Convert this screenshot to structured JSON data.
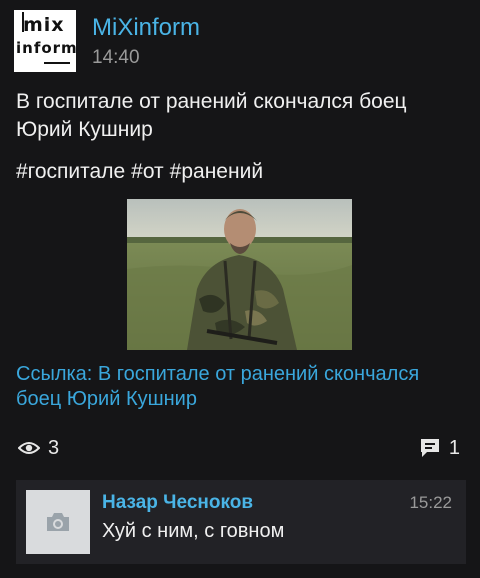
{
  "post": {
    "channel_name": "MiXinform",
    "time": "14:40",
    "logo": {
      "line1": "mix",
      "line2": "inform"
    },
    "text_line1": "В госпитале от ранений скончался боец",
    "text_line2": "Юрий Кушнир",
    "hashtags": [
      "#госпитале",
      "#от",
      "#ранений"
    ],
    "link_text": "Ссылка: В госпитале от ранений скончался боец Юрий Кушнир",
    "views_count": "3",
    "comments_count": "1"
  },
  "comment": {
    "author": "Назар Чесноков",
    "time": "15:22",
    "text": "Хуй с ним, с говном"
  },
  "colors": {
    "background": "#151517",
    "accent": "#4ab4e6",
    "link": "#3aa7dc",
    "muted": "#9a9a9a",
    "card": "#222226"
  },
  "icons": {
    "views": "eye-icon",
    "comments": "speech-bubble-icon",
    "avatar_placeholder": "camera-icon"
  }
}
